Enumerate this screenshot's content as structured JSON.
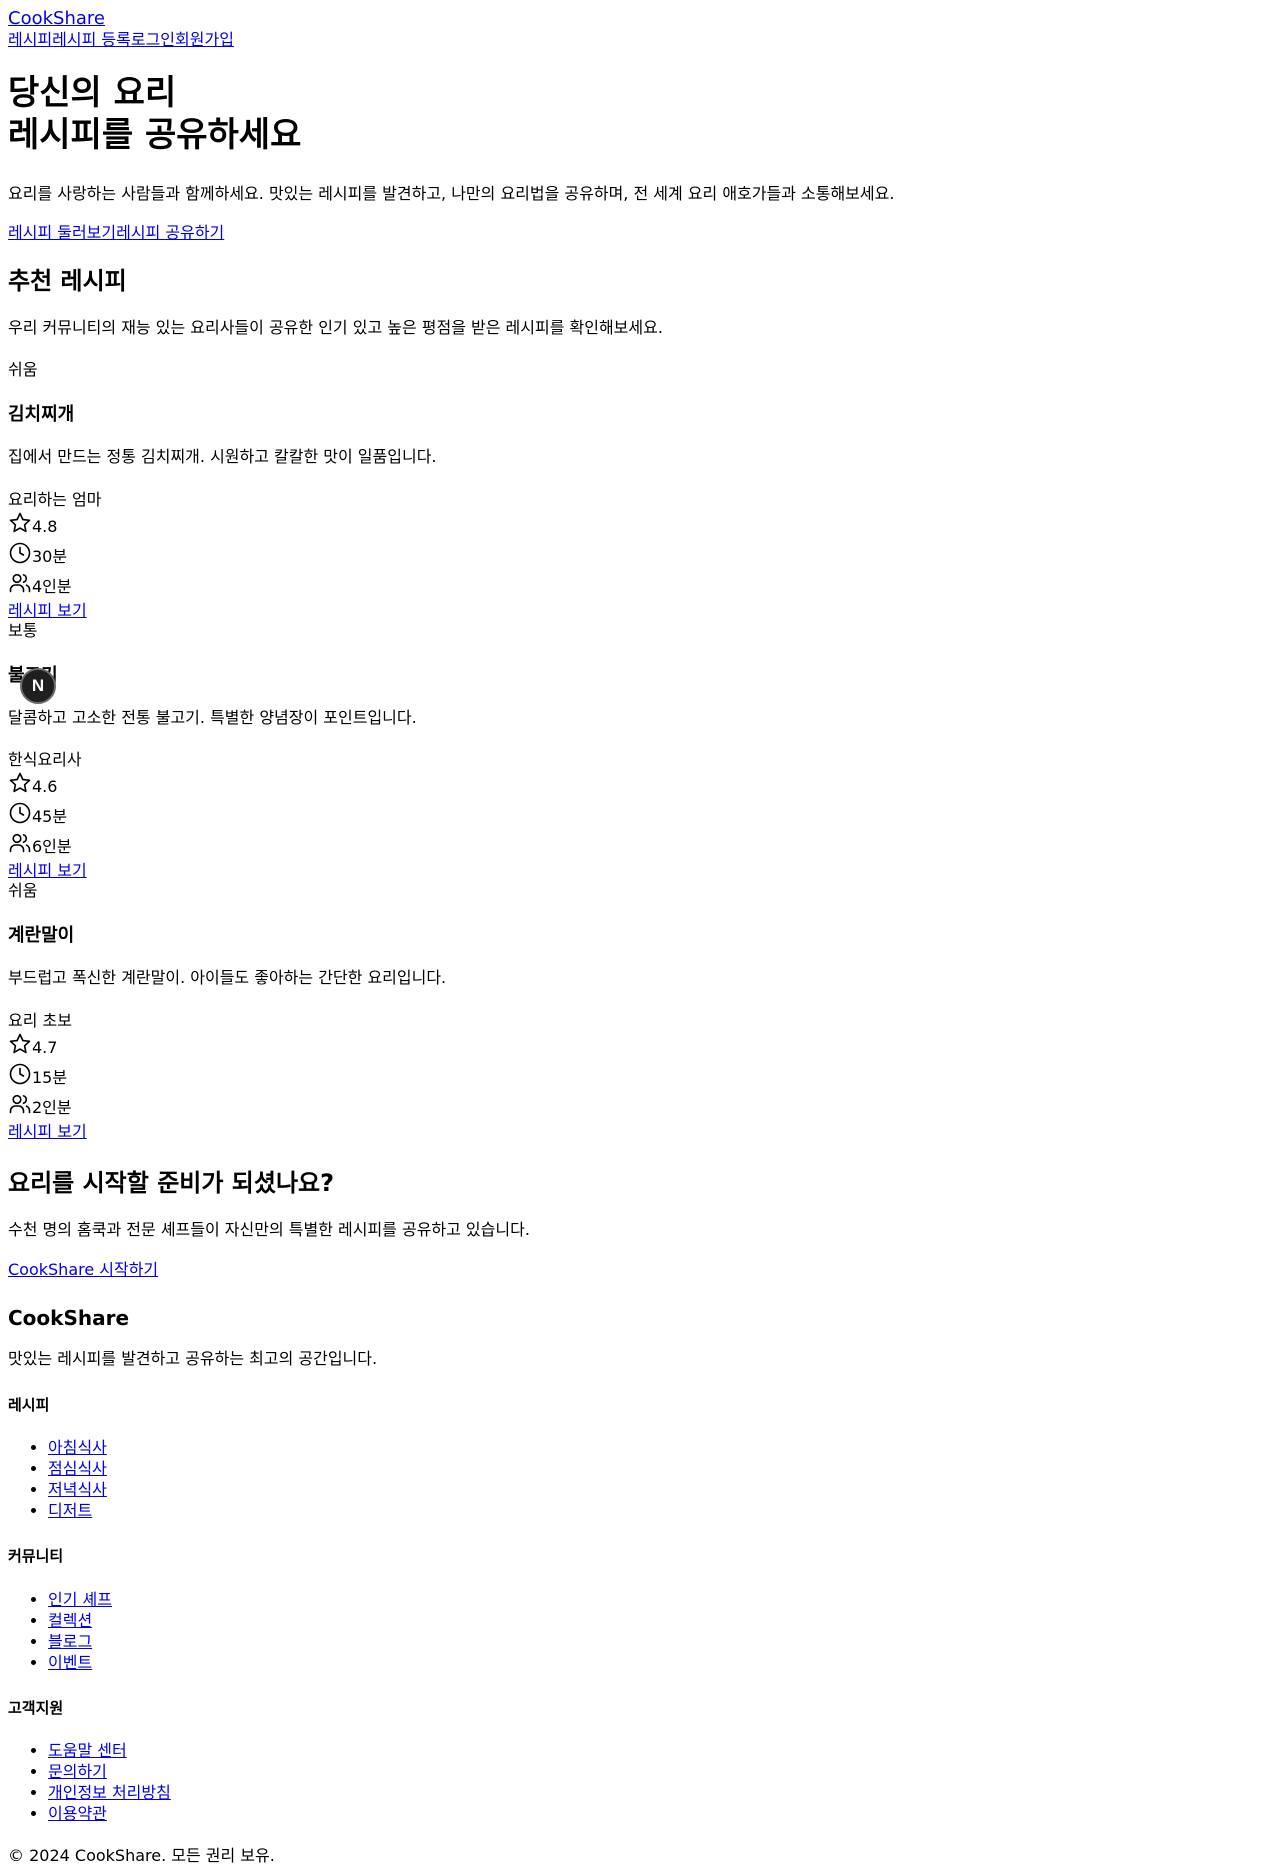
{
  "nav": {
    "logo": "CookShare",
    "links": [
      "레시피",
      "레시피 등록",
      "로그인",
      "회원가입"
    ]
  },
  "hero": {
    "title_line1": "당신의 요리",
    "title_line2": "레시피를 공유하세요",
    "description": "요리를 사랑하는 사람들과 함께하세요. 맛있는 레시피를 발견하고, 나만의 요리법을 공유하며, 전 세계 요리 애호가들과 소통해보세요.",
    "cta_browse": "레시피 둘러보기",
    "cta_share": "레시피 공유하기"
  },
  "featured": {
    "title": "추천 레시피",
    "description": "우리 커뮤니티의 재능 있는 요리사들이 공유한 인기 있고 높은 평점을 받은 레시피를 확인해보세요.",
    "recipes": [
      {
        "difficulty": "쉬움",
        "name": "김치찌개",
        "description": "집에서 만드는 정통 김치찌개. 시원하고 칼칼한 맛이 일품입니다.",
        "author": "요리하는 엄마",
        "rating": "4.8",
        "time": "30분",
        "servings": "4인분",
        "link": "레시피 보기"
      },
      {
        "difficulty": "보통",
        "name": "불고기",
        "description": "달콤하고 고소한 전통 불고기. 특별한 양념장이 포인트입니다.",
        "author": "한식요리사",
        "rating": "4.6",
        "time": "45분",
        "servings": "6인분",
        "link": "레시피 보기"
      },
      {
        "difficulty": "쉬움",
        "name": "계란말이",
        "description": "부드럽고 폭신한 계란말이. 아이들도 좋아하는 간단한 요리입니다.",
        "author": "요리 초보",
        "rating": "4.7",
        "time": "15분",
        "servings": "2인분",
        "link": "레시피 보기"
      }
    ]
  },
  "cta": {
    "title": "요리를 시작할 준비가 되셨나요?",
    "description": "수천 명의 홈쿡과 전문 셰프들이 자신만의 특별한 레시피를 공유하고 있습니다.",
    "button": "CookShare 시작하기"
  },
  "footer": {
    "brand": "CookShare",
    "tagline": "맛있는 레시피를 발견하고 공유하는 최고의 공간입니다.",
    "columns": [
      {
        "title": "레시피",
        "links": [
          "아침식사",
          "점심식사",
          "저녁식사",
          "디저트"
        ]
      },
      {
        "title": "커뮤니티",
        "links": [
          "인기 셰프",
          "컬렉션",
          "블로그",
          "이벤트"
        ]
      },
      {
        "title": "고객지원",
        "links": [
          "도움말 센터",
          "문의하기",
          "개인정보 처리방침",
          "이용약관"
        ]
      }
    ],
    "copyright": "© 2024 CookShare. 모든 권리 보유."
  },
  "overlay": {
    "avatar_letter": "N"
  },
  "icons": [
    "star-icon",
    "clock-icon",
    "users-icon"
  ]
}
